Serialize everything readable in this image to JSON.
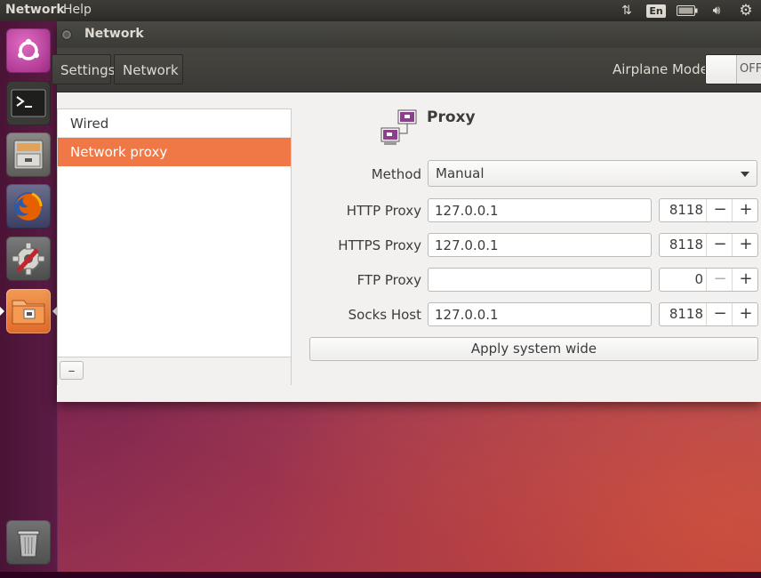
{
  "top_panel": {
    "app_menu": "Network",
    "help_menu": "Help",
    "language": "En",
    "icons": [
      "network-transfer-icon",
      "keyboard-language-icon",
      "battery-icon",
      "volume-icon",
      "system-gear-icon"
    ]
  },
  "launcher": {
    "items": [
      "ubuntu-dash",
      "terminal",
      "files",
      "firefox",
      "system-settings",
      "network-settings"
    ],
    "trash": "trash"
  },
  "window": {
    "title": "Network",
    "toolbar": {
      "breadcrumbs": [
        "Settings",
        "Network"
      ],
      "airplane_label": "Airplane Mode",
      "airplane_state": "OFF"
    },
    "devices": {
      "items": [
        {
          "label": "Wired",
          "selected": false
        },
        {
          "label": "Network proxy",
          "selected": true
        }
      ],
      "remove_label": "–"
    },
    "proxy": {
      "title": "Proxy",
      "method_label": "Method",
      "method_value": "Manual",
      "http_label": "HTTP Proxy",
      "http_host": "127.0.0.1",
      "http_port": "8118",
      "https_label": "HTTPS Proxy",
      "https_host": "127.0.0.1",
      "https_port": "8118",
      "ftp_label": "FTP Proxy",
      "ftp_host": "",
      "ftp_port": "0",
      "socks_label": "Socks Host",
      "socks_host": "127.0.0.1",
      "socks_port": "8118",
      "minus": "−",
      "plus": "+",
      "apply_label": "Apply system wide"
    }
  },
  "colors": {
    "selection": "#f07746",
    "panel": "#3b3a36",
    "launcher": "#4a1436"
  }
}
